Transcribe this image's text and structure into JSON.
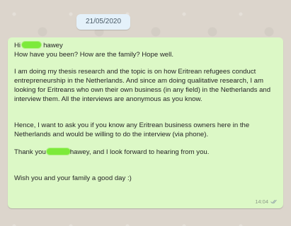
{
  "chat": {
    "date": "21/05/2020",
    "message": {
      "greet_prefix": "Hi",
      "greet_name_tail": "hawey",
      "greet_line2": "How have you been? How are the family? Hope well.",
      "paragraph_thesis": "I am doing my thesis research and the topic is on how Eritrean refugees conduct entrepreneurship in the Netherlands. And since am doing qualitative research, I am looking for Eritreans who own their own business (in any field) in the Netherlands and interview them. All the interviews are anonymous as you know.",
      "paragraph_request": "Hence, I want to ask you if you know any Eritrean business owners here in the Netherlands and would be willing to do the interview (via phone).",
      "thanks_prefix": "Thank you",
      "thanks_suffix": "hawey, and I look forward to hearing from you.",
      "closing": "Wish you and your family a good day :)",
      "time": "14:04",
      "status_icon": "double-check-icon"
    },
    "colors": {
      "bubble": "#dcf8c6",
      "redaction": "#7dea3b",
      "date_chip": "#e4f1fa"
    }
  }
}
